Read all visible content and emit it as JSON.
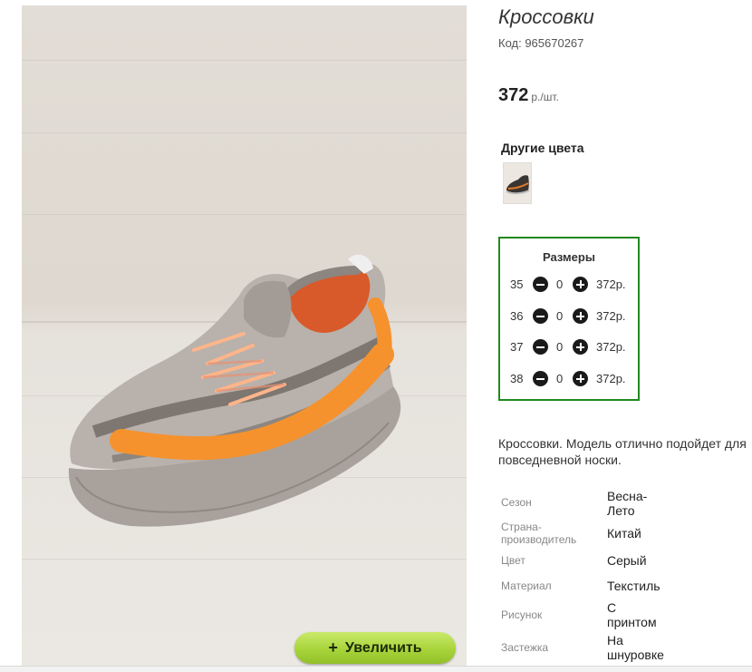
{
  "product": {
    "title": "Кроссовки",
    "code": "Код: 965670267",
    "price": "372",
    "price_unit": "р./шт."
  },
  "photo": {
    "image": "grey-orange-knit-sneaker-photo",
    "zoom_button": {
      "icon": "+",
      "label": "Увеличить"
    }
  },
  "other_colors": {
    "title": "Другие цвета",
    "thumbnail": "dark-sneaker-thumbnail"
  },
  "sizes": {
    "title": "Размеры",
    "rows": [
      {
        "size": "35",
        "qty": "0",
        "price": "372р."
      },
      {
        "size": "36",
        "qty": "0",
        "price": "372р."
      },
      {
        "size": "37",
        "qty": "0",
        "price": "372р."
      },
      {
        "size": "38",
        "qty": "0",
        "price": "372р."
      }
    ]
  },
  "description": "Кроссовки. Модель отлично подойдет для\nповседневной носки.",
  "properties": [
    {
      "key": "Сезон",
      "value": "Весна-\nЛето"
    },
    {
      "key": "Страна-\nпроизводитель",
      "value": "Китай"
    },
    {
      "key": "Цвет",
      "value": "Серый"
    },
    {
      "key": "Материал",
      "value": "Текстиль"
    },
    {
      "key": "Рисунок",
      "value": "С\nпринтом"
    },
    {
      "key": "Застежка",
      "value": "На\nшнуровке"
    }
  ],
  "colors": {
    "sizes_border": "#1f8a1f",
    "zoom_button": "#a8d43a",
    "shoe_orange": "#f5922e",
    "shoe_grey": "#9a9490"
  }
}
